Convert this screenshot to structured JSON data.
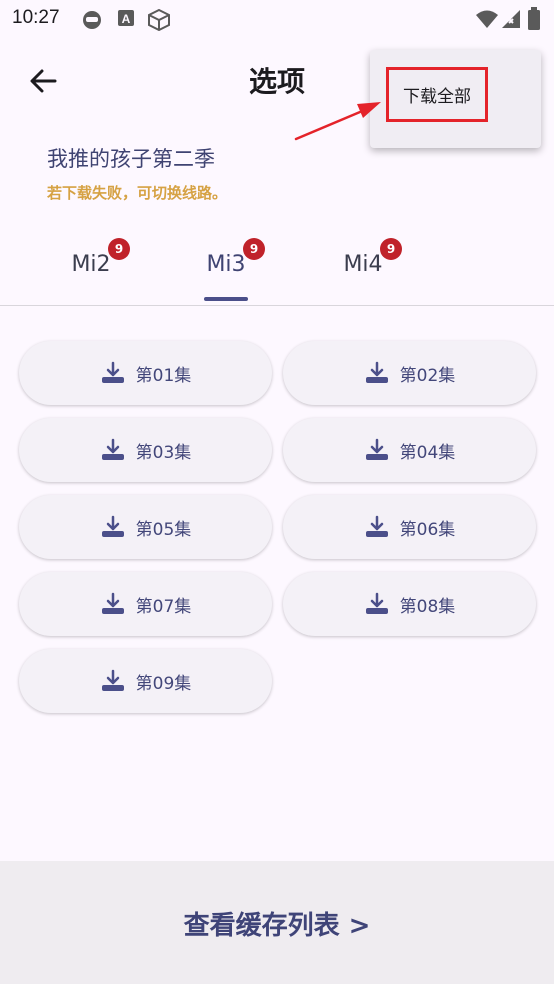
{
  "status_bar": {
    "time": "10:27",
    "left_icons": [
      "game-controller-icon",
      "a-box-icon",
      "cube-icon"
    ],
    "right_icons": [
      "wifi-icon",
      "signal-icon",
      "battery-icon"
    ]
  },
  "header": {
    "title": "选项",
    "back_icon": "arrow-left-icon"
  },
  "anime": {
    "title": "我推的孩子第二季",
    "hint": "若下载失败，可切换线路。"
  },
  "tabs": [
    {
      "label": "Mi2",
      "badge": "9",
      "selected": false
    },
    {
      "label": "Mi3",
      "badge": "9",
      "selected": true
    },
    {
      "label": "Mi4",
      "badge": "9",
      "selected": false
    }
  ],
  "episodes": [
    {
      "label": "第01集"
    },
    {
      "label": "第02集"
    },
    {
      "label": "第03集"
    },
    {
      "label": "第04集"
    },
    {
      "label": "第05集"
    },
    {
      "label": "第06集"
    },
    {
      "label": "第07集"
    },
    {
      "label": "第08集"
    },
    {
      "label": "第09集"
    }
  ],
  "bottom": {
    "label": "查看缓存列表 >"
  },
  "menu": {
    "download_all": "下载全部"
  },
  "colors": {
    "accent": "#4b4f8a",
    "hint": "#d6a244",
    "badge": "#c0222a",
    "highlight": "#e4232a"
  }
}
